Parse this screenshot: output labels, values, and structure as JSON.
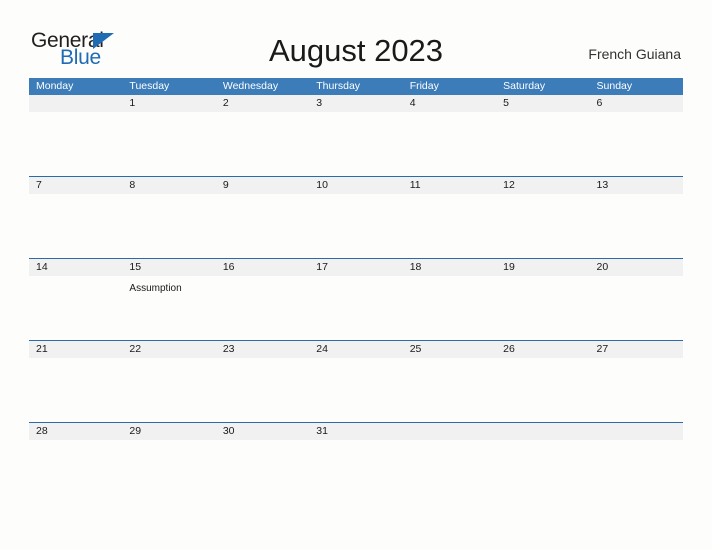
{
  "brand": {
    "name_part1": "General",
    "name_part2": "Blue",
    "triangle_color": "#1f6cb5"
  },
  "header": {
    "title": "August 2023",
    "locale": "French Guiana"
  },
  "colors": {
    "header_blue": "#3b7cb9",
    "row_divider_blue": "#2a6ca8",
    "date_band_gray": "#f1f1f1",
    "page_background": "#fdfdfc",
    "text_dark": "#1a1a1a"
  },
  "calendar": {
    "weekdays": [
      "Monday",
      "Tuesday",
      "Wednesday",
      "Thursday",
      "Friday",
      "Saturday",
      "Sunday"
    ],
    "weeks": [
      [
        {
          "day": "",
          "event": ""
        },
        {
          "day": "1",
          "event": ""
        },
        {
          "day": "2",
          "event": ""
        },
        {
          "day": "3",
          "event": ""
        },
        {
          "day": "4",
          "event": ""
        },
        {
          "day": "5",
          "event": ""
        },
        {
          "day": "6",
          "event": ""
        }
      ],
      [
        {
          "day": "7",
          "event": ""
        },
        {
          "day": "8",
          "event": ""
        },
        {
          "day": "9",
          "event": ""
        },
        {
          "day": "10",
          "event": ""
        },
        {
          "day": "11",
          "event": ""
        },
        {
          "day": "12",
          "event": ""
        },
        {
          "day": "13",
          "event": ""
        }
      ],
      [
        {
          "day": "14",
          "event": ""
        },
        {
          "day": "15",
          "event": "Assumption"
        },
        {
          "day": "16",
          "event": ""
        },
        {
          "day": "17",
          "event": ""
        },
        {
          "day": "18",
          "event": ""
        },
        {
          "day": "19",
          "event": ""
        },
        {
          "day": "20",
          "event": ""
        }
      ],
      [
        {
          "day": "21",
          "event": ""
        },
        {
          "day": "22",
          "event": ""
        },
        {
          "day": "23",
          "event": ""
        },
        {
          "day": "24",
          "event": ""
        },
        {
          "day": "25",
          "event": ""
        },
        {
          "day": "26",
          "event": ""
        },
        {
          "day": "27",
          "event": ""
        }
      ],
      [
        {
          "day": "28",
          "event": ""
        },
        {
          "day": "29",
          "event": ""
        },
        {
          "day": "30",
          "event": ""
        },
        {
          "day": "31",
          "event": ""
        },
        {
          "day": "",
          "event": ""
        },
        {
          "day": "",
          "event": ""
        },
        {
          "day": "",
          "event": ""
        }
      ]
    ]
  }
}
